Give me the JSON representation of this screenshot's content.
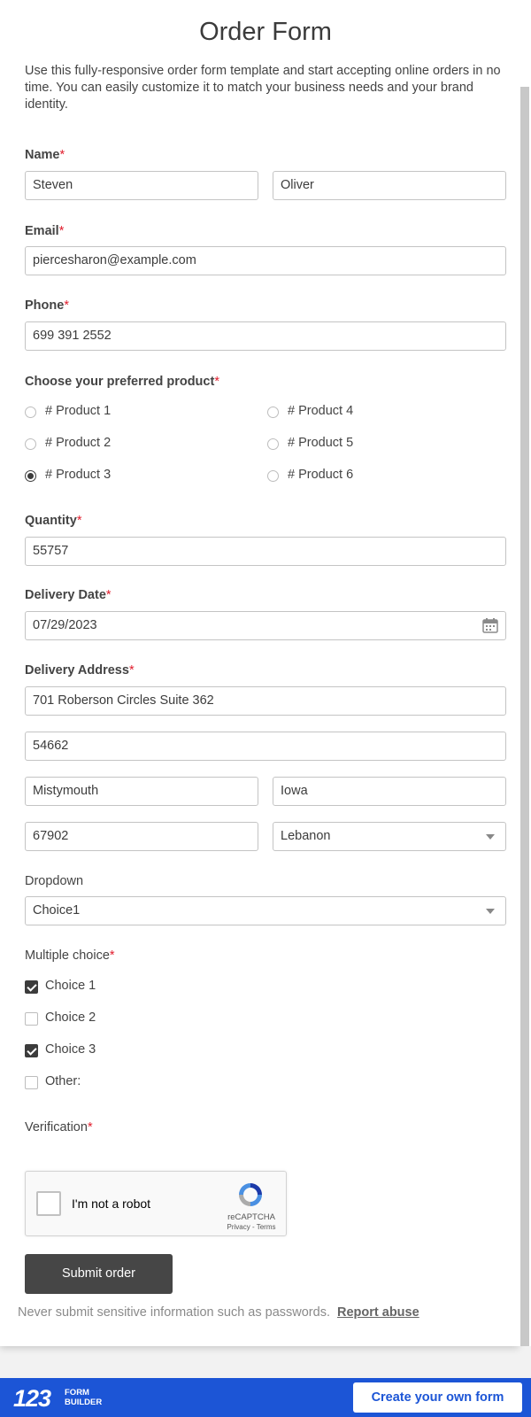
{
  "form": {
    "title": "Order Form",
    "description": "Use this fully-responsive order form template and start accepting online orders in no time. You can easily customize it to match your business needs and your brand identity."
  },
  "name": {
    "label": "Name",
    "required": "*",
    "first": "Steven",
    "last": "Oliver"
  },
  "email": {
    "label": "Email",
    "required": "*",
    "value": "piercesharon@example.com"
  },
  "phone": {
    "label": "Phone",
    "required": "*",
    "value": "699 391 2552"
  },
  "product": {
    "label": "Choose your preferred product",
    "required": "*",
    "options": [
      "# Product 1",
      "# Product 2",
      "# Product 3",
      "# Product 4",
      "# Product 5",
      "# Product 6"
    ],
    "selected": "# Product 3"
  },
  "quantity": {
    "label": "Quantity",
    "required": "*",
    "value": "55757"
  },
  "delivery_date": {
    "label": "Delivery Date",
    "required": "*",
    "value": "07/29/2023"
  },
  "address": {
    "label": "Delivery Address",
    "required": "*",
    "street": "701 Roberson Circles Suite 362",
    "line2": "54662",
    "city": "Mistymouth",
    "state": "Iowa",
    "zip": "67902",
    "country": "Lebanon"
  },
  "dropdown": {
    "label": "Dropdown",
    "value": "Choice1"
  },
  "multiple_choice": {
    "label": "Multiple choice",
    "required": "*",
    "options": [
      {
        "label": "Choice 1",
        "checked": true
      },
      {
        "label": "Choice 2",
        "checked": false
      },
      {
        "label": "Choice 3",
        "checked": true
      },
      {
        "label": "Other:",
        "checked": false
      }
    ]
  },
  "verification": {
    "label": "Verification",
    "required": "*",
    "captcha_text": "I'm not a robot",
    "captcha_brand": "reCAPTCHA",
    "captcha_links": "Privacy - Terms"
  },
  "submit_label": "Submit order",
  "footer": {
    "note": "Never submit sensitive information such as passwords.",
    "report": "Report abuse"
  },
  "bottom_bar": {
    "brand_number": "123",
    "brand_word_1": "FORM",
    "brand_word_2": "BUILDER",
    "cta": "Create your own form"
  },
  "colors": {
    "accent": "#1c55d6",
    "required": "#e11d2d",
    "button": "#464646"
  },
  "icons": {
    "calendar": "calendar-icon",
    "dropdown": "chevron-down-icon",
    "recaptcha": "recaptcha-logo-icon"
  }
}
